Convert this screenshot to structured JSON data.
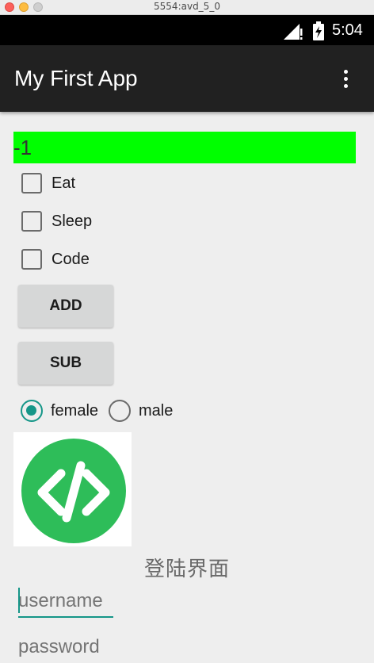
{
  "window": {
    "title": "5554:avd_5_0"
  },
  "statusbar": {
    "time": "5:04",
    "signal_icon": "signal-icon",
    "battery_icon": "battery-charging-icon"
  },
  "appbar": {
    "title": "My First App",
    "overflow_icon": "more-vert-icon"
  },
  "counter": {
    "value": "-1",
    "background": "#00ff00"
  },
  "checkboxes": [
    {
      "label": "Eat",
      "checked": false
    },
    {
      "label": "Sleep",
      "checked": false
    },
    {
      "label": "Code",
      "checked": false
    }
  ],
  "buttons": {
    "add_label": "ADD",
    "sub_label": "SUB"
  },
  "gender": {
    "options": [
      {
        "label": "female",
        "checked": true
      },
      {
        "label": "male",
        "checked": false
      }
    ],
    "accent": "#159688"
  },
  "logo": {
    "icon": "code-brackets-icon",
    "color": "#2ebd59"
  },
  "login": {
    "title": "登陆界面",
    "username_placeholder": "username",
    "password_placeholder": "password"
  }
}
